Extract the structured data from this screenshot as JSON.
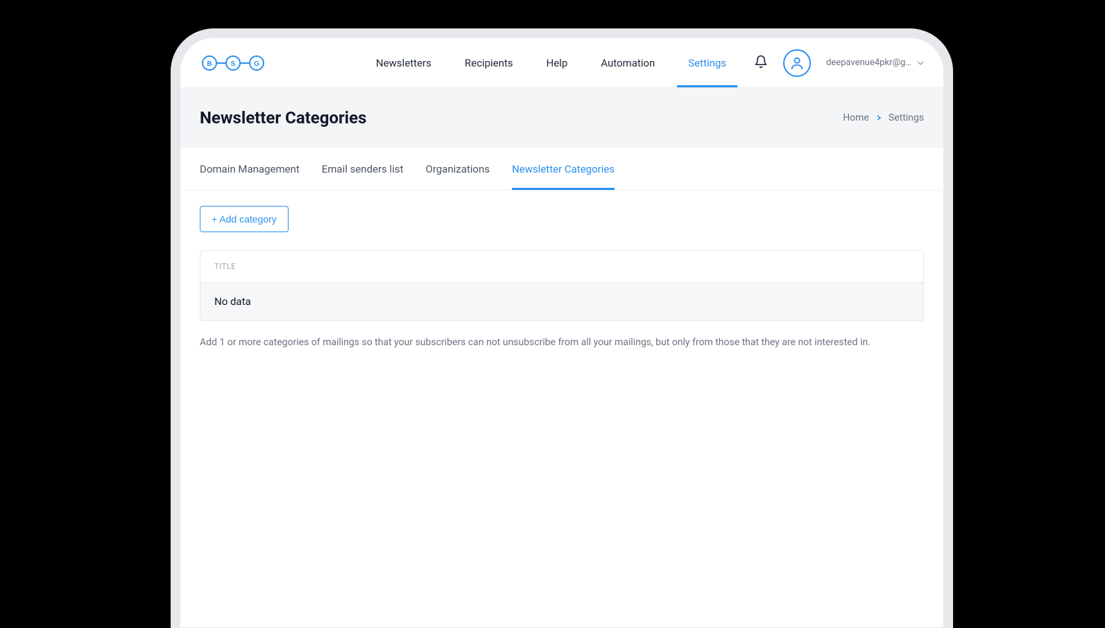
{
  "logo": {
    "letters": [
      "B",
      "S",
      "G"
    ]
  },
  "nav": {
    "items": [
      {
        "label": "Newsletters"
      },
      {
        "label": "Recipients"
      },
      {
        "label": "Help"
      },
      {
        "label": "Automation"
      },
      {
        "label": "Settings",
        "active": true
      }
    ]
  },
  "user": {
    "email": "deepavenue4pkr@g…"
  },
  "page": {
    "title": "Newsletter Categories"
  },
  "breadcrumb": {
    "home": "Home",
    "current": "Settings"
  },
  "subtabs": [
    {
      "label": "Domain Management"
    },
    {
      "label": "Email senders list"
    },
    {
      "label": "Organizations"
    },
    {
      "label": "Newsletter Categories",
      "active": true
    }
  ],
  "actions": {
    "add_category": "+ Add category"
  },
  "table": {
    "columns": [
      {
        "header": "TITLE"
      }
    ],
    "empty_message": "No data"
  },
  "help_text": "Add 1 or more categories of mailings so that your subscribers can not unsubscribe from all your mailings, but only from those that they are not interested in."
}
